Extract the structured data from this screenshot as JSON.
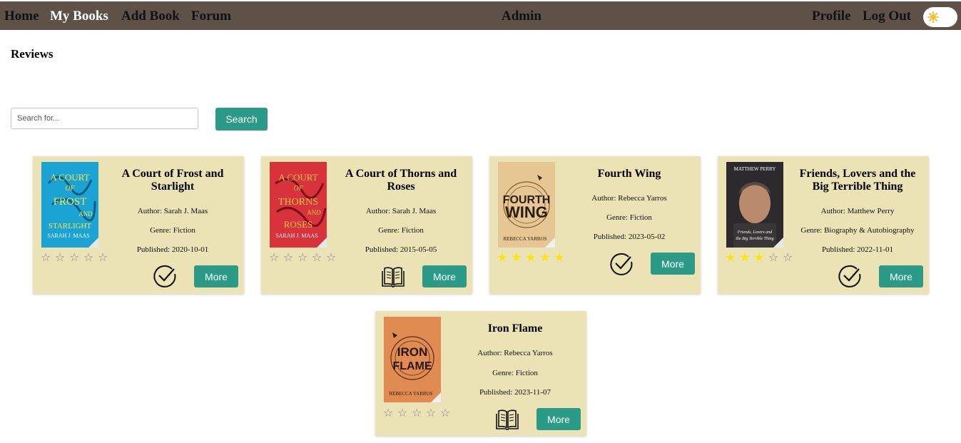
{
  "nav": {
    "home": "Home",
    "my_books": "My Books",
    "add_book": "Add Book",
    "forum": "Forum",
    "center": "Admin",
    "profile": "Profile",
    "logout": "Log Out",
    "theme_icon": "sun-icon",
    "active_color": "#ffffff",
    "bar_color": "#5e5148"
  },
  "page": {
    "heading": "Reviews"
  },
  "search": {
    "placeholder": "Search for...",
    "value": "",
    "button_label": "Search"
  },
  "colors": {
    "accent": "#2b9b87",
    "card": "#ebe2b6",
    "star_filled": "#ffe500",
    "star_empty": "#8b8b8b"
  },
  "books": [
    {
      "title_line1": "A Court of Frost and",
      "title_line2": "Starlight",
      "author": "Author: Sarah J. Maas",
      "genre": "Genre: Fiction",
      "published": "Published: 2020-10-01",
      "rating": 0,
      "status_icon": "checkmark-circle-icon",
      "more_label": "More",
      "cover_text": [
        "A COURT",
        "OF",
        "FROST",
        "AND",
        "STARLIGHT",
        "SARAH J. MAAS"
      ],
      "cover_color": "#1ba3d4"
    },
    {
      "title_line1": "A Court of Thorns and",
      "title_line2": "Roses",
      "author": "Author: Sarah J. Maas",
      "genre": "Genre: Fiction",
      "published": "Published: 2015-05-05",
      "rating": 0,
      "status_icon": "open-book-icon",
      "more_label": "More",
      "cover_text": [
        "A COURT",
        "OF",
        "THORNS",
        "AND",
        "ROSES",
        "SARAH J. MAAS"
      ],
      "cover_color": "#d8323c"
    },
    {
      "title_line1": "Fourth Wing",
      "author": "Author: Rebecca Yarros",
      "genre": "Genre: Fiction",
      "published": "Published: 2023-05-02",
      "rating": 5,
      "status_icon": "checkmark-circle-icon",
      "more_label": "More",
      "cover_text": [
        "FOURTH",
        "WING",
        "REBECCA YARROS"
      ],
      "cover_color": "#e6c692"
    },
    {
      "title_line1": "Friends, Lovers and the",
      "title_line2": "Big Terrible Thing",
      "author": "Author: Matthew Perry",
      "genre": "Genre: Biography & Autobiography",
      "published": "Published: 2022-11-01",
      "rating": 3,
      "status_icon": "checkmark-circle-icon",
      "more_label": "More",
      "cover_text": [
        "MATTHEW PERRY",
        "Friends, Lovers and",
        "the Big Terrible Thing"
      ],
      "cover_color": "#2c2a2c"
    },
    {
      "title_line1": "Iron Flame",
      "author": "Author: Rebecca Yarros",
      "genre": "Genre: Fiction",
      "published": "Published: 2023-11-07",
      "rating": 0,
      "status_icon": "open-book-icon",
      "more_label": "More",
      "cover_text": [
        "IRON",
        "FLAME",
        "REBECCA YARROS"
      ],
      "cover_color": "#e08b52"
    }
  ]
}
